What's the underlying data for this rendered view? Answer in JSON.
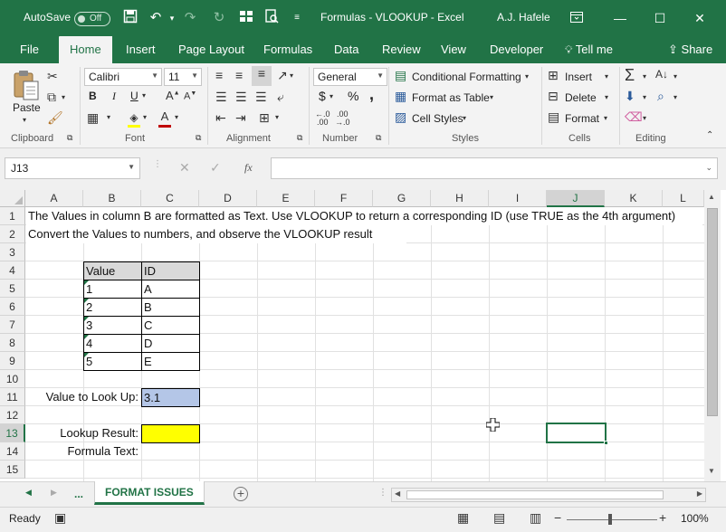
{
  "title_bar": {
    "autosave_label": "AutoSave",
    "autosave_state": "Off",
    "document_title": "Formulas - VLOOKUP  -  Excel",
    "user_name": "A.J. Hafele"
  },
  "ribbon_tabs": [
    {
      "label": "File"
    },
    {
      "label": "Home"
    },
    {
      "label": "Insert"
    },
    {
      "label": "Page Layout"
    },
    {
      "label": "Formulas"
    },
    {
      "label": "Data"
    },
    {
      "label": "Review"
    },
    {
      "label": "View"
    },
    {
      "label": "Developer"
    },
    {
      "label": "Tell me"
    },
    {
      "label": "Share"
    }
  ],
  "ribbon": {
    "clipboard": {
      "group": "Clipboard",
      "paste_label": "Paste"
    },
    "font": {
      "group": "Font",
      "font_name": "Calibri",
      "font_size": "11",
      "bold": "B",
      "italic": "I",
      "underline": "U"
    },
    "alignment": {
      "group": "Alignment"
    },
    "number": {
      "group": "Number",
      "format": "General",
      "currency": "$",
      "percent": "%",
      "comma": ","
    },
    "styles": {
      "group": "Styles",
      "conditional": "Conditional Formatting",
      "format_table": "Format as Table",
      "cell_styles": "Cell Styles"
    },
    "cells": {
      "group": "Cells",
      "insert": "Insert",
      "delete": "Delete",
      "format": "Format"
    },
    "editing": {
      "group": "Editing"
    }
  },
  "formula_bar": {
    "name_box": "J13",
    "fx": "fx",
    "formula": ""
  },
  "columns": [
    "A",
    "B",
    "C",
    "D",
    "E",
    "F",
    "G",
    "H",
    "I",
    "J",
    "K",
    "L"
  ],
  "rows": [
    "1",
    "2",
    "3",
    "4",
    "5",
    "6",
    "7",
    "8",
    "9",
    "10",
    "11",
    "12",
    "13",
    "14",
    "15"
  ],
  "cells": {
    "A1": "The Values in column B are formatted as Text.  Use VLOOKUP to return a corresponding ID (use TRUE as the 4th argument)",
    "A2": "Convert the Values to numbers, and observe the VLOOKUP result",
    "B4": "Value",
    "C4": "ID",
    "B5": "1",
    "C5": "A",
    "B6": "2",
    "C6": "B",
    "B7": "3",
    "C7": "C",
    "B8": "4",
    "C8": "D",
    "B9": "5",
    "C9": "E",
    "A11": "Value to Look Up:",
    "C11": "3.1",
    "A13": "Lookup Result:",
    "C13": "",
    "A14": "Formula Text:"
  },
  "colors": {
    "excel_green": "#217346",
    "lookup_fill": "#b4c6e7",
    "result_fill": "#ffff00",
    "header_fill": "#d9d9d9"
  },
  "sheet_tabs": {
    "ellipsis": "...",
    "active": "FORMAT ISSUES"
  },
  "status_bar": {
    "status": "Ready",
    "zoom": "100%"
  }
}
